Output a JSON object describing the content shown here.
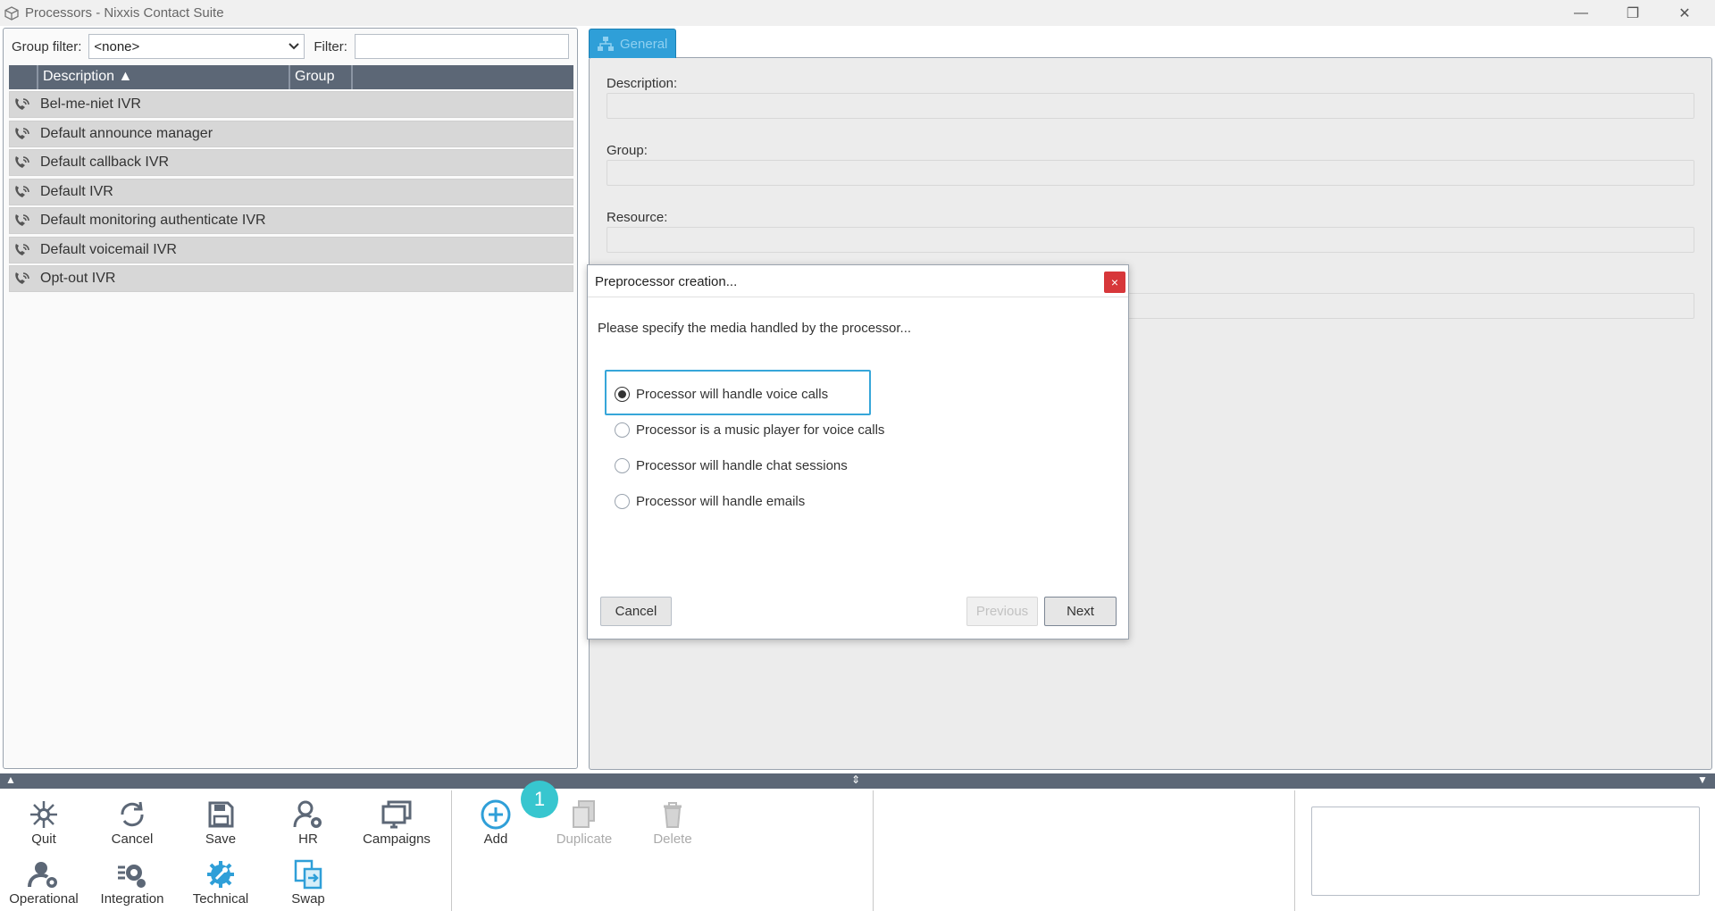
{
  "window": {
    "title": "Processors - Nixxis Contact Suite",
    "minimize": "—",
    "restore": "❐",
    "close": "✕"
  },
  "filterbar": {
    "group_label": "Group filter:",
    "group_value": "<none>",
    "filter_label": "Filter:",
    "filter_value": ""
  },
  "grid": {
    "columns": [
      "",
      "Description ▲",
      "Group"
    ],
    "rows": [
      "Bel-me-niet IVR",
      "Default announce manager",
      "Default callback IVR",
      "Default IVR",
      "Default monitoring authenticate IVR",
      "Default voicemail IVR",
      "Opt-out IVR"
    ]
  },
  "details": {
    "tab_label": "General",
    "fields": {
      "description": "Description:",
      "group": "Group:",
      "resource": "Resource:"
    }
  },
  "dialog": {
    "title": "Preprocessor creation...",
    "close": "×",
    "prompt": "Please specify the media handled by the processor...",
    "options": [
      "Processor will handle voice calls",
      "Processor is a music player for voice calls",
      "Processor will handle chat sessions",
      "Processor will handle emails"
    ],
    "selected_index": 0,
    "buttons": {
      "cancel": "Cancel",
      "previous": "Previous",
      "next": "Next"
    }
  },
  "toolbar": {
    "quit": "Quit",
    "cancel": "Cancel",
    "save": "Save",
    "hr": "HR",
    "campaigns": "Campaigns",
    "operational": "Operational",
    "integration": "Integration",
    "technical": "Technical",
    "swap": "Swap",
    "add": "Add",
    "duplicate": "Duplicate",
    "delete": "Delete"
  },
  "badge": "1",
  "colors": {
    "accent": "#2f9fd8",
    "header": "#5c6776",
    "close": "#d7373a",
    "badge": "#37c6cf"
  }
}
